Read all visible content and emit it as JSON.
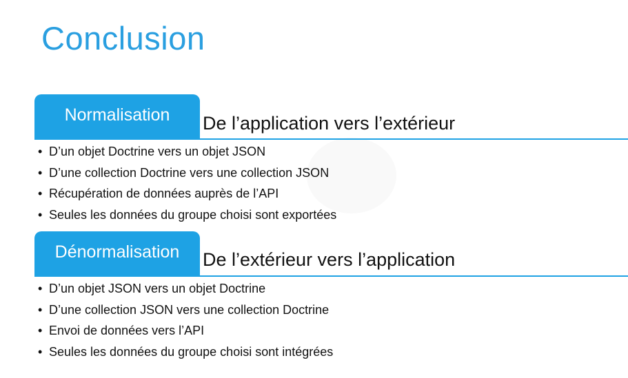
{
  "title": "Conclusion",
  "sections": [
    {
      "tab_label": "Normalisation",
      "subtitle": "De l’application vers l’extérieur",
      "bullets": [
        "D’un objet Doctrine vers un objet JSON",
        "D’une collection Doctrine vers une collection JSON",
        "Récupération de données auprès de l’API",
        "Seules les données du groupe choisi sont exportées"
      ]
    },
    {
      "tab_label": "Dénormalisation",
      "subtitle": "De l’extérieur vers l’application",
      "bullets": [
        "D’un objet JSON vers un objet Doctrine",
        "D’une collection JSON vers une collection Doctrine",
        "Envoi de données vers l’API",
        "Seules les données du groupe choisi sont intégrées"
      ]
    }
  ],
  "colors": {
    "accent": "#1ea2e4",
    "title": "#2a9fe0",
    "text": "#111111"
  }
}
